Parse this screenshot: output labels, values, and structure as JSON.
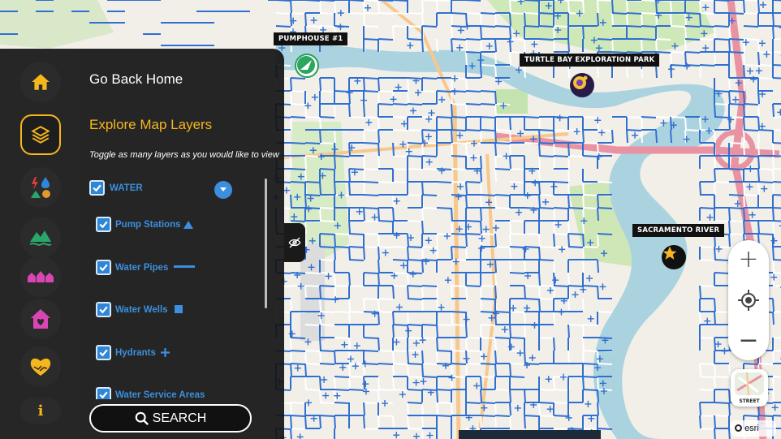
{
  "map": {
    "labels": {
      "pumphouse": "PUMPHOUSE #1",
      "turtle_bay": "TURTLE BAY EXPLORATION PARK",
      "sacramento_river": "SACRAMENTO RIVER"
    },
    "attribution": "esri"
  },
  "rail": {
    "home_icon": "home-icon",
    "layers_icon": "layers-icon",
    "utilities_icon": "utilities-icon",
    "landscape_icon": "landscape-icon",
    "neighborhood_icon": "neighborhood-icon",
    "house_icon": "house-heart-icon",
    "community_icon": "heart-hands-icon",
    "info_icon": "info-icon",
    "info_glyph": "i"
  },
  "panel": {
    "home_link": "Go Back Home",
    "layers_title": "Explore Map Layers",
    "layers_subtitle": "Toggle as many layers as you would like to view",
    "group": {
      "label": "WATER",
      "checked": true
    },
    "layers": [
      {
        "label": "Pump Stations",
        "checked": true,
        "symbol": "triangle"
      },
      {
        "label": "Water Pipes",
        "checked": true,
        "symbol": "line"
      },
      {
        "label": "Water Wells",
        "checked": true,
        "symbol": "square"
      },
      {
        "label": "Hydrants",
        "checked": true,
        "symbol": "plus"
      },
      {
        "label": "Water Service Areas",
        "checked": true,
        "symbol": "area"
      }
    ],
    "search_label": "SEARCH"
  },
  "controls": {
    "zoom_in": "+",
    "locate": "locate-icon",
    "zoom_out": "−",
    "basemap_label": "STREET"
  },
  "colors": {
    "accent": "#f6b61e",
    "layer_blue": "#3b8fde",
    "pipe_blue": "#2f6fd0",
    "river": "#aad3df",
    "park": "#c8e6b0",
    "highway": "#e892a2"
  }
}
